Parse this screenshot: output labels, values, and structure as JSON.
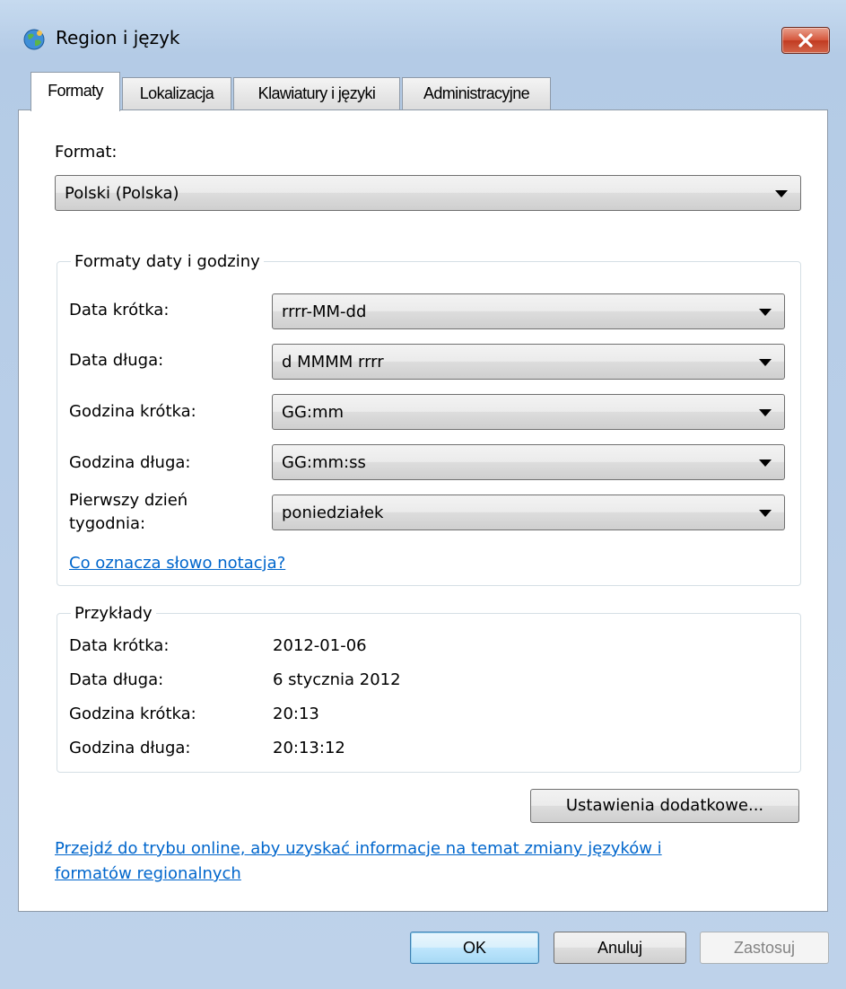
{
  "window": {
    "title": "Region i język",
    "icons": {
      "app": "globe-region-icon",
      "close": "close-icon"
    }
  },
  "tabs": [
    {
      "label": "Formaty",
      "active": true
    },
    {
      "label": "Lokalizacja",
      "active": false
    },
    {
      "label": "Klawiatury i języki",
      "active": false
    },
    {
      "label": "Administracyjne",
      "active": false
    }
  ],
  "format": {
    "label": "Format:",
    "value": "Polski (Polska)"
  },
  "date_time_formats": {
    "legend": "Formaty daty i godziny",
    "rows": [
      {
        "label": "Data krótka:",
        "value": "rrrr-MM-dd"
      },
      {
        "label": "Data długa:",
        "value": "d MMMM rrrr"
      },
      {
        "label": "Godzina krótka:",
        "value": "GG:mm"
      },
      {
        "label": "Godzina długa:",
        "value": "GG:mm:ss"
      },
      {
        "label_line1": "Pierwszy dzień",
        "label_line2": "tygodnia:",
        "value": "poniedziałek"
      }
    ],
    "notation_link": "Co oznacza słowo notacja?"
  },
  "examples": {
    "legend": "Przykłady",
    "rows": [
      {
        "label": "Data krótka:",
        "value": "2012-01-06"
      },
      {
        "label": "Data długa:",
        "value": "6 stycznia 2012"
      },
      {
        "label": "Godzina krótka:",
        "value": "20:13"
      },
      {
        "label": "Godzina długa:",
        "value": "20:13:12"
      }
    ]
  },
  "additional_settings_button": "Ustawienia dodatkowe...",
  "online_link": {
    "line1": "Przejdź do trybu online, aby uzyskać informacje na temat zmiany języków i",
    "line2": "formatów regionalnych"
  },
  "buttons": {
    "ok": "OK",
    "cancel": "Anuluj",
    "apply": "Zastosuj"
  },
  "colors": {
    "link": "#0066cc",
    "window_frame": "#bcd2ea",
    "close_button": "#c13b21"
  }
}
